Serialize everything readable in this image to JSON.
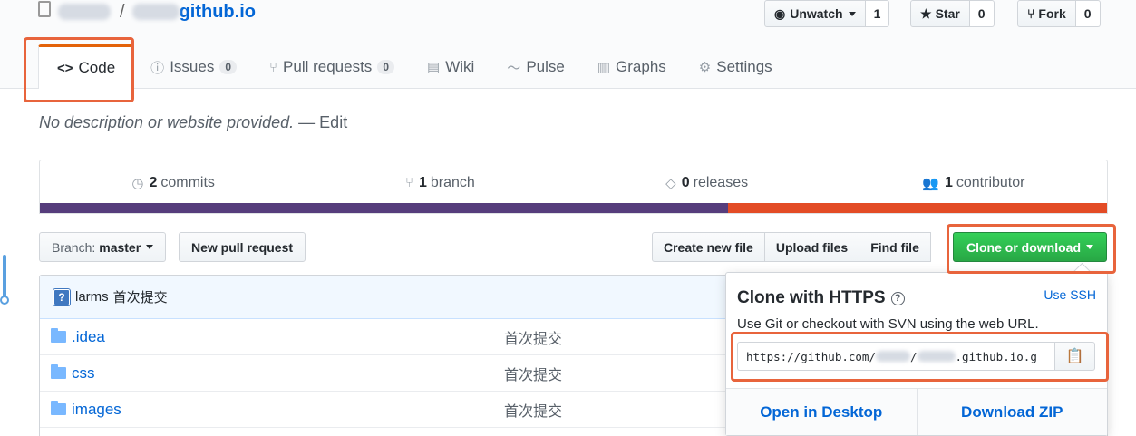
{
  "repo": {
    "separator": "/",
    "name_suffix": "github.io"
  },
  "actions": [
    {
      "label": "Unwatch",
      "count": "1",
      "icon": "eye-icon"
    },
    {
      "label": "Star",
      "count": "0",
      "icon": "star-icon"
    },
    {
      "label": "Fork",
      "count": "0",
      "icon": "fork-icon"
    }
  ],
  "tabs": [
    {
      "label": "Code",
      "icon": "<>",
      "selected": true
    },
    {
      "label": "Issues",
      "icon": "ⓘ",
      "counter": "0"
    },
    {
      "label": "Pull requests",
      "icon": "⑂",
      "counter": "0"
    },
    {
      "label": "Wiki",
      "icon": "▤"
    },
    {
      "label": "Pulse",
      "icon": "〜"
    },
    {
      "label": "Graphs",
      "icon": "▥"
    },
    {
      "label": "Settings",
      "icon": "⚙"
    }
  ],
  "description": {
    "text": "No description or website provided.",
    "edit": "— Edit"
  },
  "summary": {
    "commits": {
      "count": "2",
      "label": "commits",
      "icon": "history-icon"
    },
    "branch": {
      "count": "1",
      "label": "branch",
      "icon": "branch-icon"
    },
    "releases": {
      "count": "0",
      "label": "releases",
      "icon": "tag-icon"
    },
    "contributors": {
      "count": "1",
      "label": "contributor",
      "icon": "people-icon"
    },
    "language_colors": [
      "#563d7c",
      "#e34c26"
    ],
    "language_fractions": [
      0.645,
      0.355
    ]
  },
  "toolbar": {
    "branch_prefix": "Branch:",
    "branch_value": "master",
    "new_pull_request": "New pull request",
    "create_new_file": "Create new file",
    "upload_files": "Upload files",
    "find_file": "Find file",
    "clone_or_download": "Clone or download"
  },
  "latest_commit": {
    "avatar_text": "?",
    "author": "larms",
    "message": "首次提交"
  },
  "files": [
    {
      "name": ".idea",
      "message": "首次提交"
    },
    {
      "name": "css",
      "message": "首次提交"
    },
    {
      "name": "images",
      "message": "首次提交"
    }
  ],
  "clone_popup": {
    "title": "Clone with HTTPS",
    "use_ssh": "Use SSH",
    "subtitle": "Use Git or checkout with SVN using the web URL.",
    "url_prefix": "https://github.com/",
    "url_mid": "/",
    "url_suffix": ".github.io.g",
    "open_in_desktop": "Open in Desktop",
    "download_zip": "Download ZIP"
  },
  "colors": {
    "accent_green": "#28a745",
    "link_blue": "#0366d6",
    "highlight_orange": "#e8643c",
    "tab_top_border": "#e36209"
  }
}
